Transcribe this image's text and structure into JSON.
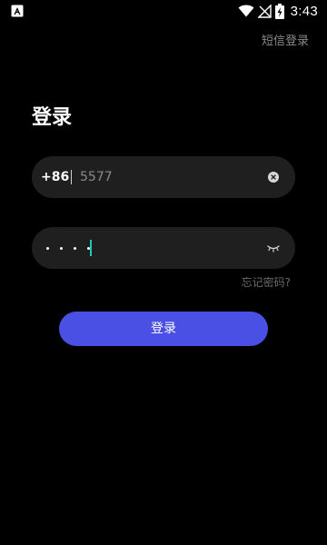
{
  "status_bar": {
    "time": "3:43",
    "icons": [
      "app-notification-icon",
      "wifi-icon",
      "no-signal-icon",
      "battery-charging-icon"
    ]
  },
  "header": {
    "sms_login_label": "短信登录"
  },
  "main": {
    "title": "登录",
    "phone": {
      "country_code": "+86",
      "value": "5577",
      "clear_icon": "clear-icon"
    },
    "password": {
      "masked_length": 4,
      "toggle_icon": "eye-closed-icon",
      "cursor_color": "#20c9b7"
    },
    "forgot_password_label": "忘记密码?",
    "login_button_label": "登录"
  },
  "colors": {
    "background": "#000000",
    "field_background": "#1f1f1f",
    "accent": "#4a50e3",
    "muted_text": "#8a8a8a"
  }
}
